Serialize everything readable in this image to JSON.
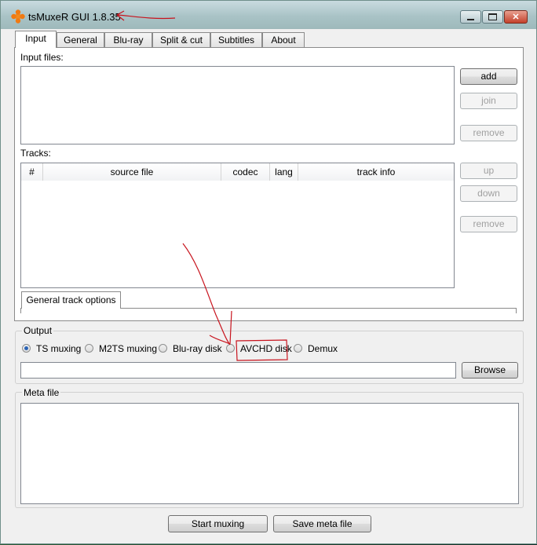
{
  "window": {
    "title": "tsMuxeR GUI 1.8.35",
    "controls": {
      "minimize": "minimize-icon",
      "maximize": "maximize-icon",
      "close": "close-icon"
    }
  },
  "tabs": [
    {
      "label": "Input",
      "active": true
    },
    {
      "label": "General"
    },
    {
      "label": "Blu-ray"
    },
    {
      "label": "Split & cut"
    },
    {
      "label": "Subtitles"
    },
    {
      "label": "About"
    }
  ],
  "input": {
    "files_label": "Input files:",
    "add_label": "add",
    "join_label": "join",
    "remove_label": "remove"
  },
  "tracks": {
    "label": "Tracks:",
    "columns": [
      "#",
      "source file",
      "codec",
      "lang",
      "track info"
    ],
    "up_label": "up",
    "down_label": "down",
    "remove_label": "remove",
    "options_tab": "General track options"
  },
  "output": {
    "label": "Output",
    "options": [
      {
        "label": "TS muxing",
        "selected": true
      },
      {
        "label": "M2TS muxing",
        "selected": false
      },
      {
        "label": "Blu-ray disk",
        "selected": false
      },
      {
        "label": "AVCHD disk",
        "selected": false
      },
      {
        "label": "Demux",
        "selected": false
      }
    ],
    "path_value": "",
    "browse_label": "Browse"
  },
  "meta": {
    "label": "Meta file",
    "content": ""
  },
  "actions": {
    "start_label": "Start muxing",
    "save_label": "Save meta file"
  },
  "colors": {
    "annotation": "#c8141e",
    "radio_selected": "#2b63b5"
  }
}
